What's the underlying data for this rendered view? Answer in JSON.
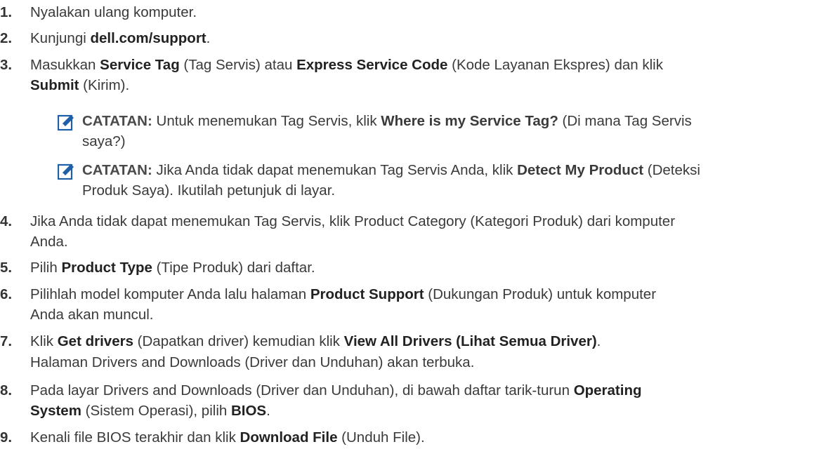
{
  "colors": {
    "text": "#3a3a3a",
    "bold": "#222222",
    "icon": "#1f5fa8"
  },
  "steps": [
    {
      "num": "1.",
      "parts": [
        {
          "t": "Nyalakan ulang komputer.",
          "b": false
        }
      ]
    },
    {
      "num": "2.",
      "parts": [
        {
          "t": "Kunjungi ",
          "b": false
        },
        {
          "t": "dell.com/support",
          "b": true
        },
        {
          "t": ".",
          "b": false
        }
      ]
    },
    {
      "num": "3.",
      "parts": [
        {
          "t": "Masukkan ",
          "b": false
        },
        {
          "t": "Service Tag",
          "b": true
        },
        {
          "t": " (Tag Servis) atau ",
          "b": false
        },
        {
          "t": "Express Service Code",
          "b": true
        },
        {
          "t": " (Kode Layanan Ekspres) dan klik",
          "b": false
        },
        {
          "br": true
        },
        {
          "t": "Submit",
          "b": true
        },
        {
          "t": " (Kirim).",
          "b": false
        }
      ]
    },
    {
      "num": "4.",
      "parts": [
        {
          "t": "Jika Anda tidak dapat menemukan Tag Servis, klik Product Category (Kategori Produk) dari komputer",
          "b": false
        },
        {
          "br": true
        },
        {
          "t": "Anda.",
          "b": false
        }
      ]
    },
    {
      "num": "5.",
      "parts": [
        {
          "t": "Pilih ",
          "b": false
        },
        {
          "t": "Product Type",
          "b": true
        },
        {
          "t": " (Tipe Produk) dari daftar.",
          "b": false
        }
      ]
    },
    {
      "num": "6.",
      "parts": [
        {
          "t": "Pilihlah model komputer Anda lalu halaman ",
          "b": false
        },
        {
          "t": "Product Support",
          "b": true
        },
        {
          "t": " (Dukungan Produk) untuk komputer",
          "b": false
        },
        {
          "br": true
        },
        {
          "t": "Anda akan muncul.",
          "b": false
        }
      ]
    },
    {
      "num": "7.",
      "parts": [
        {
          "t": "Klik ",
          "b": false
        },
        {
          "t": "Get drivers",
          "b": true
        },
        {
          "t": " (Dapatkan driver) kemudian klik ",
          "b": false
        },
        {
          "t": "View All Drivers (Lihat Semua Driver)",
          "b": true
        },
        {
          "t": ".",
          "b": false
        }
      ]
    },
    {
      "num": "8.",
      "parts": [
        {
          "t": "Pada layar Drivers and Downloads (Driver dan Unduhan), di bawah daftar tarik-turun ",
          "b": false
        },
        {
          "t": "Operating",
          "b": true
        },
        {
          "br": true
        },
        {
          "t": "System",
          "b": true
        },
        {
          "t": " (Sistem Operasi), pilih ",
          "b": false
        },
        {
          "t": "BIOS",
          "b": true
        },
        {
          "t": ".",
          "b": false
        }
      ]
    },
    {
      "num": "9.",
      "parts": [
        {
          "t": "Kenali file BIOS terakhir dan klik ",
          "b": false
        },
        {
          "t": "Download File",
          "b": true
        },
        {
          "t": " (Unduh File).",
          "b": false
        }
      ]
    }
  ],
  "notes": [
    {
      "icon": "note-pencil-icon",
      "parts": [
        {
          "t": "CATATAN:",
          "lbl": true
        },
        {
          "t": " Untuk menemukan Tag Servis, klik ",
          "b": false
        },
        {
          "t": "Where is my Service Tag?",
          "b": true
        },
        {
          "t": " (Di mana Tag Servis",
          "b": false
        },
        {
          "br": true
        },
        {
          "t": "saya?)",
          "b": false
        }
      ]
    },
    {
      "icon": "note-pencil-icon",
      "parts": [
        {
          "t": "CATATAN:",
          "lbl": true
        },
        {
          "t": " Jika Anda tidak dapat menemukan Tag Servis Anda, klik ",
          "b": false
        },
        {
          "t": "Detect My Product",
          "b": true
        },
        {
          "t": " (Deteksi",
          "b": false
        },
        {
          "br": true
        },
        {
          "t": "Produk Saya). Ikutilah petunjuk di layar.",
          "b": false
        }
      ]
    }
  ],
  "step7_sub": "Halaman Drivers and Downloads (Driver dan Unduhan) akan terbuka."
}
